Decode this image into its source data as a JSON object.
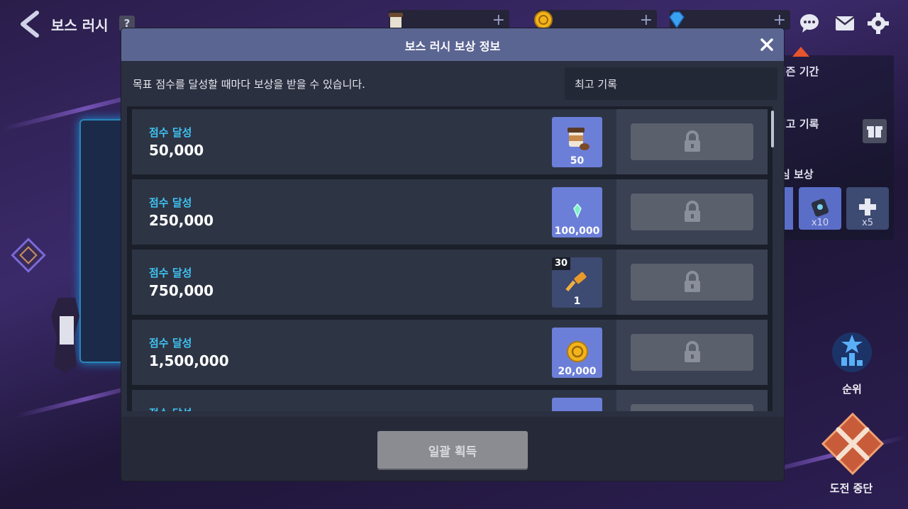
{
  "header": {
    "title": "보스 러시",
    "help_label": "?"
  },
  "currencies": [
    {
      "icon": "coffee-icon",
      "plus": "+"
    },
    {
      "icon": "gold-coin-icon",
      "plus": "+"
    },
    {
      "icon": "gem-icon",
      "plus": "+"
    }
  ],
  "background": {
    "season_label": "시즌 기간",
    "best_label": "최고 기록",
    "reward_label": "심 보상",
    "mini_items": [
      "x10",
      "x5"
    ],
    "rank_label": "순위",
    "stop_label": "도전 중단"
  },
  "modal": {
    "title": "보스 러시 보상 정보",
    "description": "목표 점수를 달성할 때마다 보상을 받을 수 있습니다.",
    "best_record_label": "최고 기록",
    "claim_all_label": "일괄 획득",
    "rows": [
      {
        "label": "점수 달성",
        "score": "50,000",
        "reward_icon": "coffee-icon",
        "reward_qty": "50",
        "badge": ""
      },
      {
        "label": "점수 달성",
        "score": "250,000",
        "reward_icon": "crystal-icon",
        "reward_qty": "100,000",
        "badge": ""
      },
      {
        "label": "점수 달성",
        "score": "750,000",
        "reward_icon": "hammer-icon",
        "reward_qty": "1",
        "badge": "30"
      },
      {
        "label": "점수 달성",
        "score": "1,500,000",
        "reward_icon": "gold-coin-icon",
        "reward_qty": "20,000",
        "badge": ""
      },
      {
        "label": "점수 달성",
        "score": "",
        "reward_icon": "",
        "reward_qty": "",
        "badge": ""
      }
    ]
  },
  "colors": {
    "accent": "#3fc3f2",
    "header": "#5b6592",
    "reward_bg": "#6c7fd8"
  }
}
